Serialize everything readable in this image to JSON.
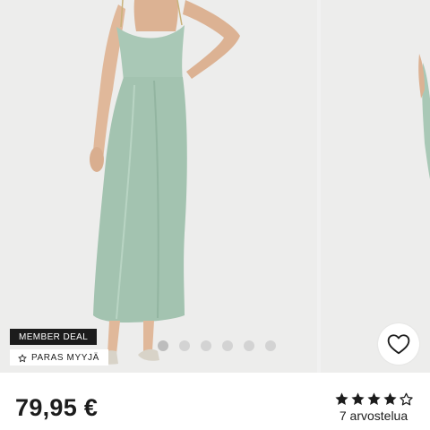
{
  "product": {
    "price": "79,95 €",
    "badges": {
      "member_deal": "MEMBER DEAL",
      "bestseller": "PARAS MYYJÄ"
    },
    "rating": {
      "value": 4,
      "max": 5,
      "reviews_label": "7 arvostelua"
    }
  },
  "gallery": {
    "image_count": 6,
    "active_index": 0
  },
  "colors": {
    "dress": "#a9c8b6",
    "badge_dark": "#1c1c1c",
    "background": "#ededec"
  },
  "icons": {
    "favorite": "heart-outline-icon",
    "bestseller": "star-outline-icon",
    "rating": "star-icon"
  }
}
